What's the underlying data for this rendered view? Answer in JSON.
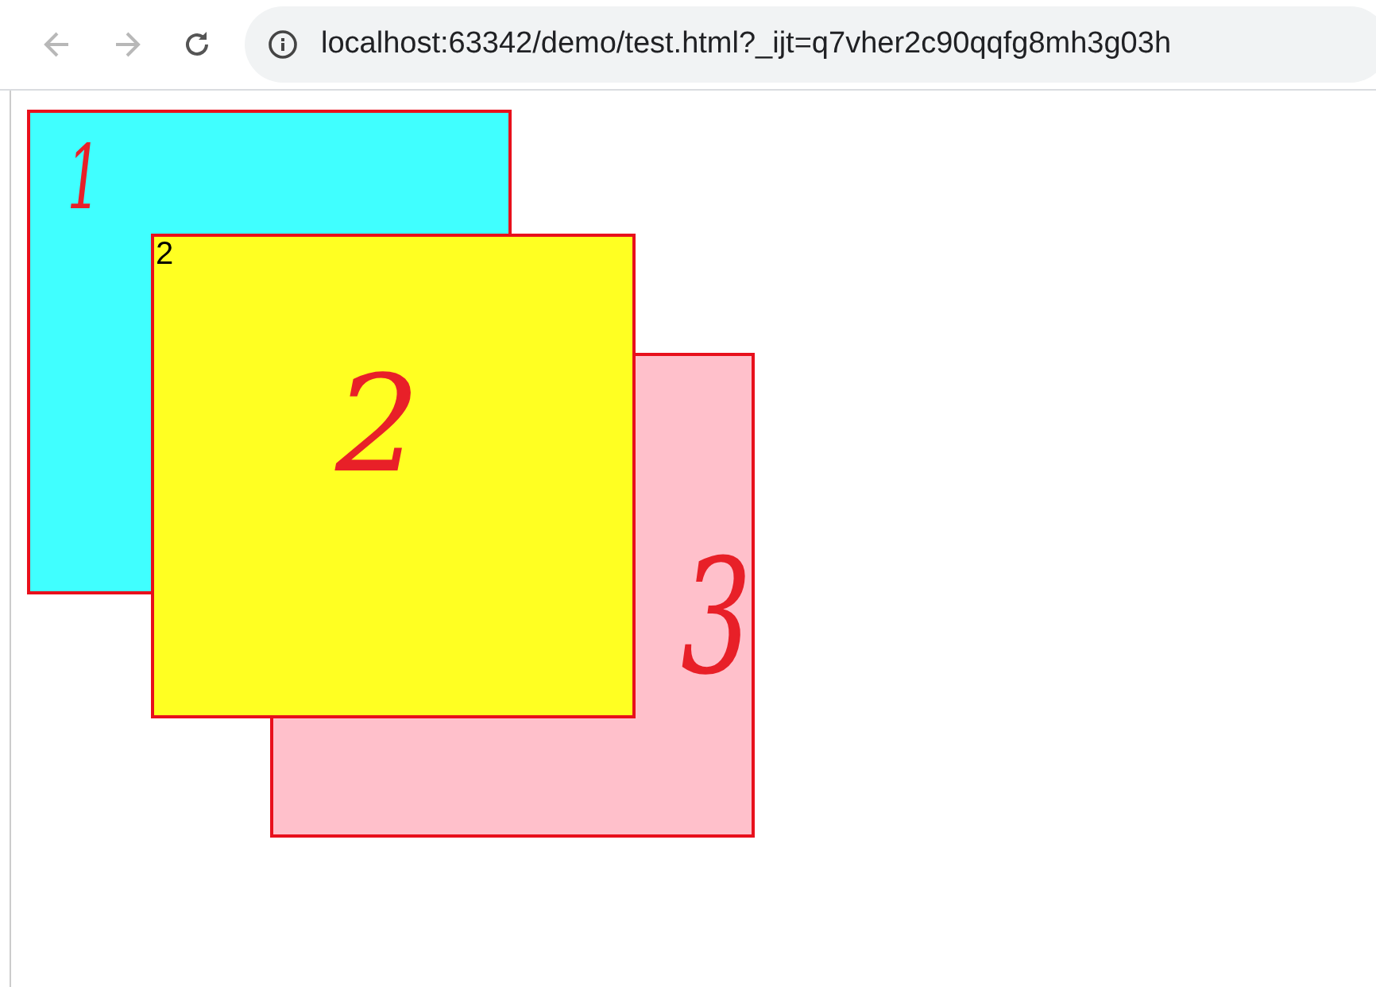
{
  "browser": {
    "url": "localhost:63342/demo/test.html?_ijt=q7vher2c90qqfg8mh3g03h"
  },
  "boxes": [
    {
      "color": "#40ffff",
      "annotation": "1"
    },
    {
      "color": "#ffc0cb",
      "annotation": "3"
    },
    {
      "color": "#ffff22",
      "text": "2",
      "annotation": "2"
    }
  ]
}
